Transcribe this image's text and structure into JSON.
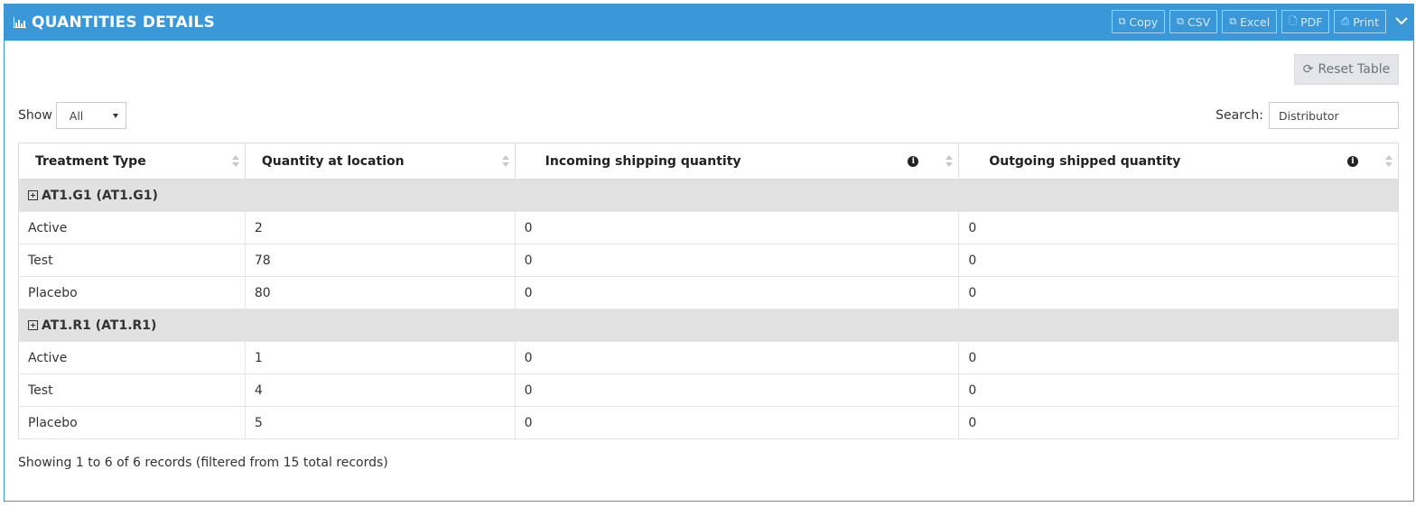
{
  "panel": {
    "title": "QUANTITIES DETAILS",
    "title_icon": "bar-chart-icon",
    "buttons": [
      {
        "label": "Copy",
        "icon": "copy-icon"
      },
      {
        "label": "CSV",
        "icon": "copy-icon"
      },
      {
        "label": "Excel",
        "icon": "copy-icon"
      },
      {
        "label": "PDF",
        "icon": "file-icon"
      },
      {
        "label": "Print",
        "icon": "print-icon"
      }
    ],
    "collapse_icon": "chevron-down-icon",
    "header_color": "#3a97d8"
  },
  "toolbar": {
    "reset_label": "Reset Table",
    "show_label": "Show",
    "show_value": "All",
    "search_label": "Search:",
    "search_value": "Distributor"
  },
  "table": {
    "columns": [
      "Treatment Type",
      "Quantity at location",
      "Incoming shipping quantity",
      "Outgoing shipped quantity"
    ],
    "groups": [
      {
        "label": "AT1.G1 (AT1.G1)",
        "rows": [
          [
            "Active",
            "2",
            "0",
            "0"
          ],
          [
            "Test",
            "78",
            "0",
            "0"
          ],
          [
            "Placebo",
            "80",
            "0",
            "0"
          ]
        ]
      },
      {
        "label": "AT1.R1 (AT1.R1)",
        "rows": [
          [
            "Active",
            "1",
            "0",
            "0"
          ],
          [
            "Test",
            "4",
            "0",
            "0"
          ],
          [
            "Placebo",
            "5",
            "0",
            "0"
          ]
        ]
      }
    ]
  },
  "footer": {
    "info": "Showing 1 to 6 of 6 records (filtered from 15 total records)"
  }
}
